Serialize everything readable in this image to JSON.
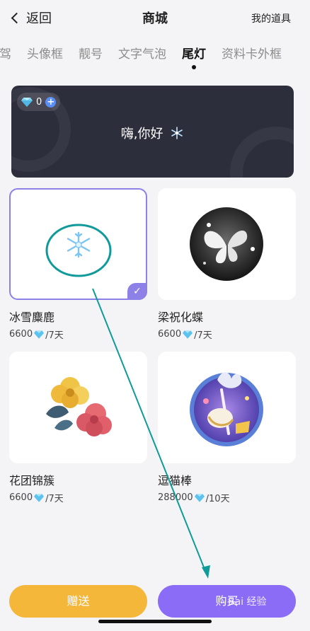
{
  "header": {
    "back_label": "返回",
    "title": "商城",
    "tools_label": "我的道具"
  },
  "tabs": [
    {
      "label": "驾",
      "active": false
    },
    {
      "label": "头像框",
      "active": false
    },
    {
      "label": "靓号",
      "active": false
    },
    {
      "label": "文字气泡",
      "active": false
    },
    {
      "label": "尾灯",
      "active": true
    },
    {
      "label": "资料卡外框",
      "active": false
    }
  ],
  "preview": {
    "gem_count": "0",
    "greeting": "嗨,你好"
  },
  "items": [
    {
      "name": "冰雪麋鹿",
      "price": "6600",
      "unit": "/7天",
      "selected": true
    },
    {
      "name": "梁祝化蝶",
      "price": "6600",
      "unit": "/7天",
      "selected": false
    },
    {
      "name": "花团锦簇",
      "price": "6600",
      "unit": "/7天",
      "selected": false
    },
    {
      "name": "逗猫棒",
      "price": "288000",
      "unit": "/10天",
      "selected": false
    }
  ],
  "actions": {
    "gift_label": "赠送",
    "buy_label": "购买"
  },
  "watermark": "Bai 经验",
  "colors": {
    "accent": "#8a6cf6",
    "gift": "#f4b73a",
    "annotation": "#109a9a"
  }
}
